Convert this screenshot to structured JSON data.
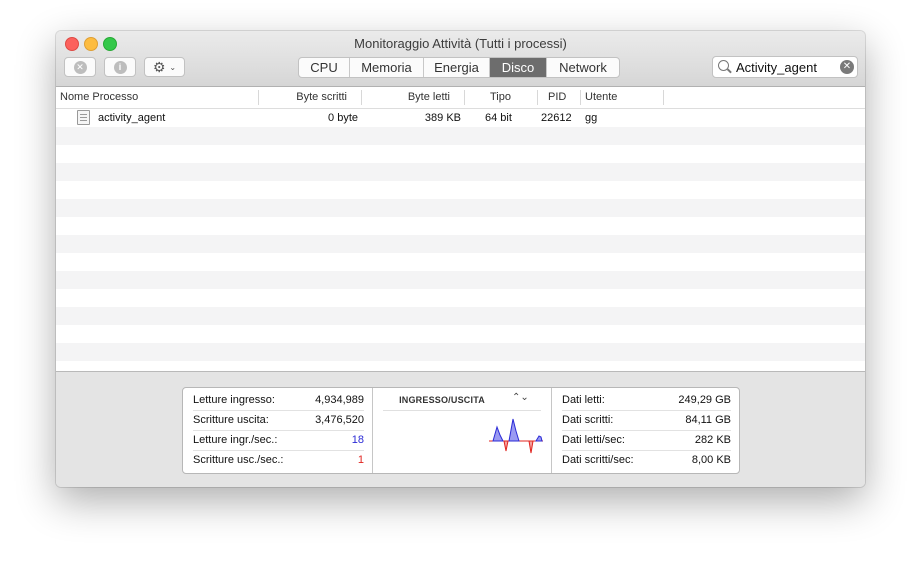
{
  "window": {
    "title": "Monitoraggio Attività (Tutti i processi)"
  },
  "toolbar": {
    "stop_glyph": "✕",
    "info_glyph": "i",
    "gear_glyph": "⚙",
    "chevron_glyph": "⌄",
    "tabs": [
      {
        "label": "CPU"
      },
      {
        "label": "Memoria"
      },
      {
        "label": "Energia"
      },
      {
        "label": "Disco",
        "active": true
      },
      {
        "label": "Network"
      }
    ],
    "search": {
      "value": "Activity_agent",
      "clear_glyph": "✕"
    }
  },
  "table": {
    "columns": [
      "Nome Processo",
      "Byte scritti",
      "Byte letti",
      "Tipo",
      "PID",
      "Utente"
    ],
    "rows": [
      {
        "name": "activity_agent",
        "bytes_written": "0 byte",
        "bytes_read": "389 KB",
        "type": "64 bit",
        "pid": "22612",
        "user": "gg"
      }
    ]
  },
  "stats": {
    "left": [
      {
        "label": "Letture ingresso:",
        "value": "4,934,989"
      },
      {
        "label": "Scritture uscita:",
        "value": "3,476,520"
      },
      {
        "label": "Letture ingr./sec.:",
        "value": "18"
      },
      {
        "label": "Scritture usc./sec.:",
        "value": "1"
      }
    ],
    "graph": {
      "title": "INGRESSO/USCITA",
      "toggle_glyph": "⌃⌄"
    },
    "right": [
      {
        "label": "Dati letti:",
        "value": "249,29 GB"
      },
      {
        "label": "Dati scritti:",
        "value": "84,11 GB"
      },
      {
        "label": "Dati letti/sec:",
        "value": "282 KB"
      },
      {
        "label": "Dati scritti/sec:",
        "value": "8,00 KB"
      }
    ]
  },
  "colors": {
    "reads": "#2b2bd6",
    "writes": "#e0241f",
    "active_tab": "#6d6d6d"
  }
}
